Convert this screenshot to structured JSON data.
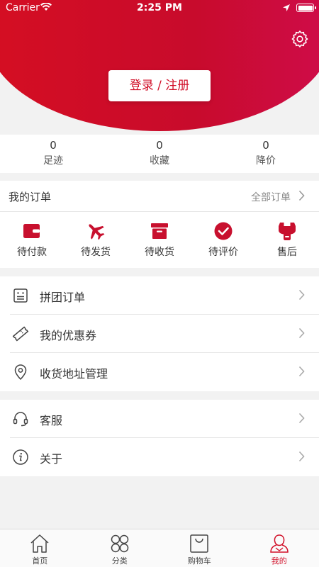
{
  "status_bar": {
    "carrier": "Carrier",
    "time": "2:25 PM"
  },
  "header": {
    "login_label": "登录 / 注册"
  },
  "stats": [
    {
      "value": "0",
      "label": "足迹"
    },
    {
      "value": "0",
      "label": "收藏"
    },
    {
      "value": "0",
      "label": "降价"
    }
  ],
  "orders": {
    "title": "我的订单",
    "all_label": "全部订单",
    "items": [
      {
        "label": "待付款",
        "icon": "wallet-icon"
      },
      {
        "label": "待发货",
        "icon": "airplane-icon"
      },
      {
        "label": "待收货",
        "icon": "box-icon"
      },
      {
        "label": "待评价",
        "icon": "check-circle-icon"
      },
      {
        "label": "售后",
        "icon": "wrench-icon"
      }
    ]
  },
  "menu_group_1": [
    {
      "label": "拼团订单",
      "icon": "group-order-icon"
    },
    {
      "label": "我的优惠券",
      "icon": "coupon-icon"
    },
    {
      "label": "收货地址管理",
      "icon": "location-pin-icon"
    }
  ],
  "menu_group_2": [
    {
      "label": "客服",
      "icon": "headset-icon"
    },
    {
      "label": "关于",
      "icon": "info-icon"
    }
  ],
  "tabbar": [
    {
      "label": "首页",
      "icon": "home-icon"
    },
    {
      "label": "分类",
      "icon": "category-icon"
    },
    {
      "label": "购物车",
      "icon": "cart-icon"
    },
    {
      "label": "我的",
      "icon": "user-icon",
      "active": true
    }
  ],
  "colors": {
    "brand": "#d10f28",
    "icon_red": "#c8102e"
  }
}
